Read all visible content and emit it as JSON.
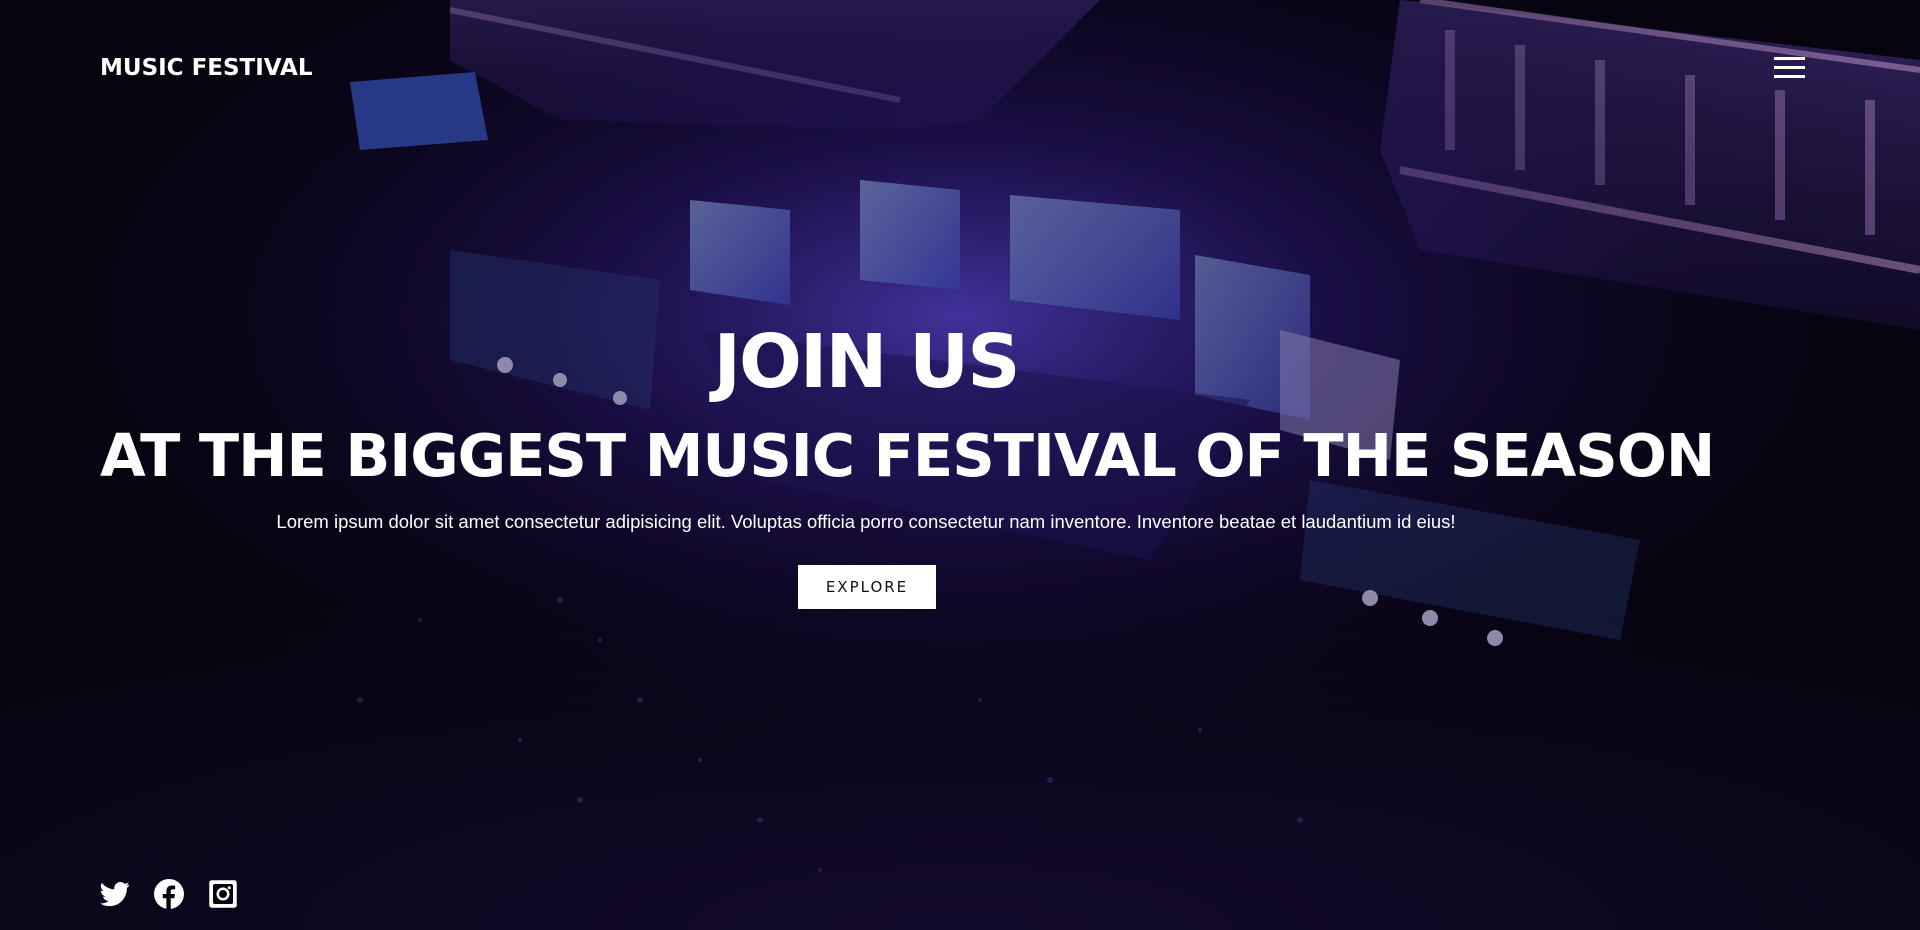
{
  "header": {
    "brand": "MUSIC FESTIVAL",
    "menu_icon": "hamburger-menu-icon"
  },
  "hero": {
    "title": "JOIN US",
    "subtitle": "AT THE BIGGEST MUSIC FESTIVAL OF THE SEASON",
    "text": "Lorem ipsum dolor sit amet consectetur adipisicing elit. Voluptas officia porro consectetur nam inventore. Inventore beatae et laudantium id eius!",
    "cta_label": "EXPLORE"
  },
  "social": {
    "items": [
      {
        "icon": "twitter-icon"
      },
      {
        "icon": "facebook-icon"
      },
      {
        "icon": "instagram-icon"
      }
    ]
  },
  "colors": {
    "overlay": "#07040f",
    "accent": "#7b5cff",
    "text": "#ffffff"
  }
}
